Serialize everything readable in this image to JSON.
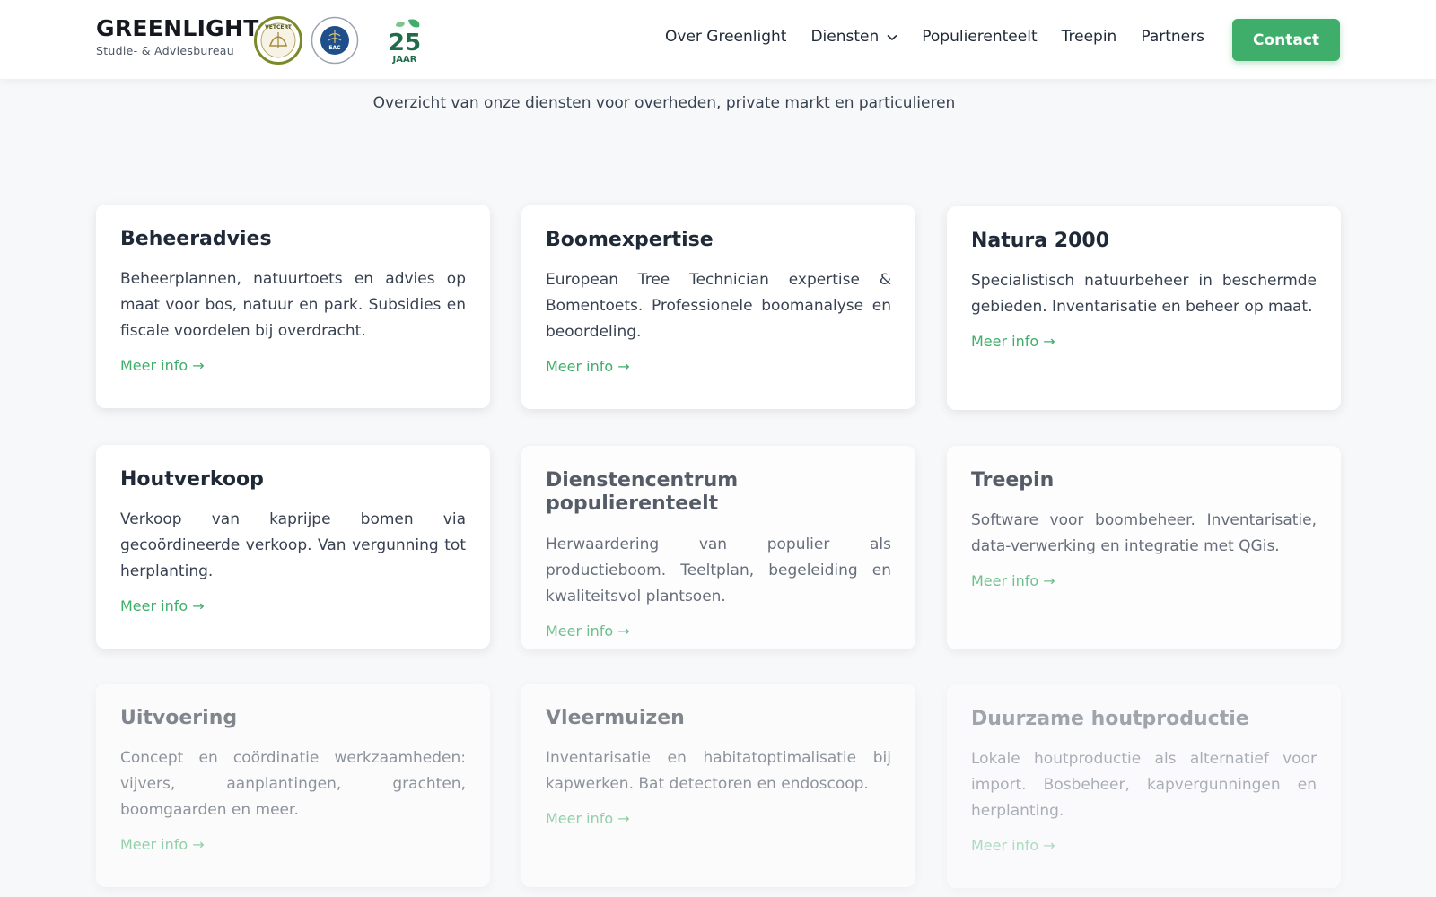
{
  "brand": {
    "name": "GREENLIGHT",
    "tagline": "Studie- & Adviesbureau",
    "logo_vetcert_text": "VETCERT",
    "logo_eac_text": "EAC",
    "logo_25_number": "25",
    "logo_25_text": "JAAR"
  },
  "nav": {
    "items": [
      {
        "label": "Over Greenlight"
      },
      {
        "label": "Diensten"
      },
      {
        "label": "Populierenteelt"
      },
      {
        "label": "Treepin"
      },
      {
        "label": "Partners"
      }
    ],
    "contact_label": "Contact"
  },
  "subtitle": "Overzicht van onze diensten voor overheden, private markt en particulieren",
  "colors": {
    "accent": "#3fae6a",
    "text": "#1f2937",
    "background": "#f7f8fa"
  },
  "cards": [
    {
      "title": "Beheeradvies",
      "text": "Beheerplannen, natuurtoets en advies op maat voor bos, natuur en park. Subsidies en fiscale voordelen bij overdracht.",
      "link": "Meer info →"
    },
    {
      "title": "Boomexpertise",
      "text": "European Tree Technician expertise & Bomentoets. Professionele boomanalyse en beoordeling.",
      "link": "Meer info →"
    },
    {
      "title": "Natura 2000",
      "text": "Specialistisch natuurbeheer in beschermde gebieden. Inventarisatie en beheer op maat.",
      "link": "Meer info →"
    },
    {
      "title": "Houtverkoop",
      "text": "Verkoop van kaprijpe bomen via gecoördineerde verkoop. Van vergunning tot herplanting.",
      "link": "Meer info →"
    },
    {
      "title": "Dienstencentrum populierenteelt",
      "text": "Herwaardering van populier als productieboom. Teeltplan, begeleiding en kwaliteitsvol plantsoen.",
      "link": "Meer info →"
    },
    {
      "title": "Treepin",
      "text": "Software voor boombeheer. Inventarisatie, data-verwerking en integratie met QGis.",
      "link": "Meer info →"
    },
    {
      "title": "Uitvoering",
      "text": "Concept en coördinatie werkzaamheden: vijvers, aanplantingen, grachten, boomgaarden en meer.",
      "link": "Meer info →"
    },
    {
      "title": "Vleermuizen",
      "text": "Inventarisatie en habitatoptimalisatie bij kapwerken. Bat detectoren en endoscoop.",
      "link": "Meer info →"
    },
    {
      "title": "Duurzame houtproductie",
      "text": "Lokale houtproductie als alternatief voor import. Bosbeheer, kapvergunningen en herplanting.",
      "link": "Meer info →"
    }
  ]
}
